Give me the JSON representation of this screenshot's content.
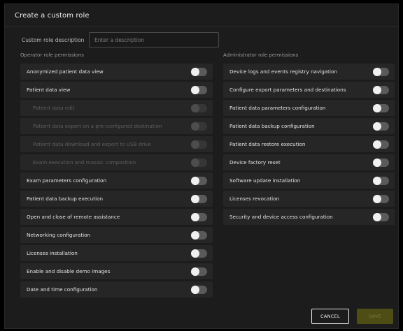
{
  "dialog": {
    "title": "Create a custom role",
    "description_label": "Custom role description",
    "description_value": "",
    "description_placeholder": "Enter a description",
    "cancel_label": "CANCEL",
    "save_label": "SAVE"
  },
  "operator": {
    "title": "Operator role permissions",
    "items": [
      {
        "label": "Anonymized patient data view",
        "enabled": false,
        "sub": false
      },
      {
        "label": "Patient data view",
        "enabled": false,
        "sub": false
      },
      {
        "label": "Patient data edit",
        "enabled": false,
        "sub": true
      },
      {
        "label": "Patient data export on a pre-configured destination",
        "enabled": false,
        "sub": true
      },
      {
        "label": "Patient data download and export to USB drive",
        "enabled": false,
        "sub": true
      },
      {
        "label": "Exam execution and mosaic composition",
        "enabled": false,
        "sub": true
      },
      {
        "label": "Exam parameters configuration",
        "enabled": false,
        "sub": false
      },
      {
        "label": "Patient data backup execution",
        "enabled": false,
        "sub": false
      },
      {
        "label": "Open and close of remote assistance",
        "enabled": false,
        "sub": false
      },
      {
        "label": "Networking configuration",
        "enabled": false,
        "sub": false
      },
      {
        "label": "Licenses installation",
        "enabled": false,
        "sub": false
      },
      {
        "label": "Enable and disable demo images",
        "enabled": false,
        "sub": false
      },
      {
        "label": "Date and time configuration",
        "enabled": false,
        "sub": false
      }
    ]
  },
  "admin": {
    "title": "Administrator role permissions",
    "items": [
      {
        "label": "Device logs and events registry navigation",
        "enabled": false,
        "sub": false
      },
      {
        "label": "Configure export parameters and destinations",
        "enabled": false,
        "sub": false
      },
      {
        "label": "Patient data parameters configuration",
        "enabled": false,
        "sub": false
      },
      {
        "label": "Patient data backup configuration",
        "enabled": false,
        "sub": false
      },
      {
        "label": "Patient data restore execution",
        "enabled": false,
        "sub": false
      },
      {
        "label": "Device factory reset",
        "enabled": false,
        "sub": false
      },
      {
        "label": "Software update installation",
        "enabled": false,
        "sub": false
      },
      {
        "label": "Licenses revocation",
        "enabled": false,
        "sub": false
      },
      {
        "label": "Security and device access configuration",
        "enabled": false,
        "sub": false
      }
    ]
  },
  "colors": {
    "background": "#000000",
    "dialog_bg": "#1c1c1c",
    "row_bg": "#262626",
    "toggle_off_track": "#5a5a5a",
    "toggle_knob": "#f0f0f0",
    "save_disabled": "#4e4d15"
  }
}
